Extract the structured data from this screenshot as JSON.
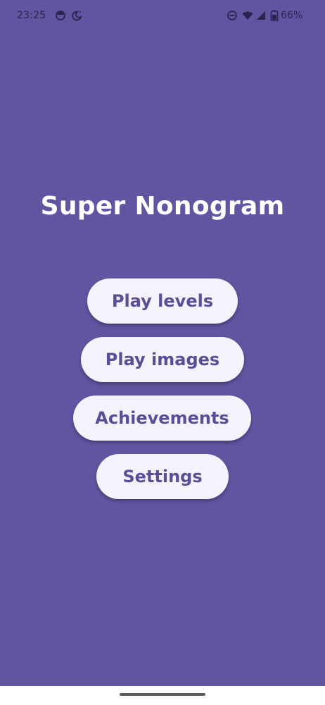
{
  "status_bar": {
    "time": "23:25",
    "battery": "66%",
    "icons": [
      "app-notification-icon",
      "do-not-disturb-moon-icon",
      "dnd-minus-icon",
      "wifi-icon",
      "signal-icon",
      "battery-icon"
    ]
  },
  "app": {
    "title": "Super Nonogram"
  },
  "menu": {
    "play_levels": "Play levels",
    "play_images": "Play images",
    "achievements": "Achievements",
    "settings": "Settings"
  },
  "colors": {
    "background": "#5F55A0",
    "button_bg": "#F4F2FB",
    "button_text": "#5A4F96",
    "title_text": "#FFFFFF"
  }
}
